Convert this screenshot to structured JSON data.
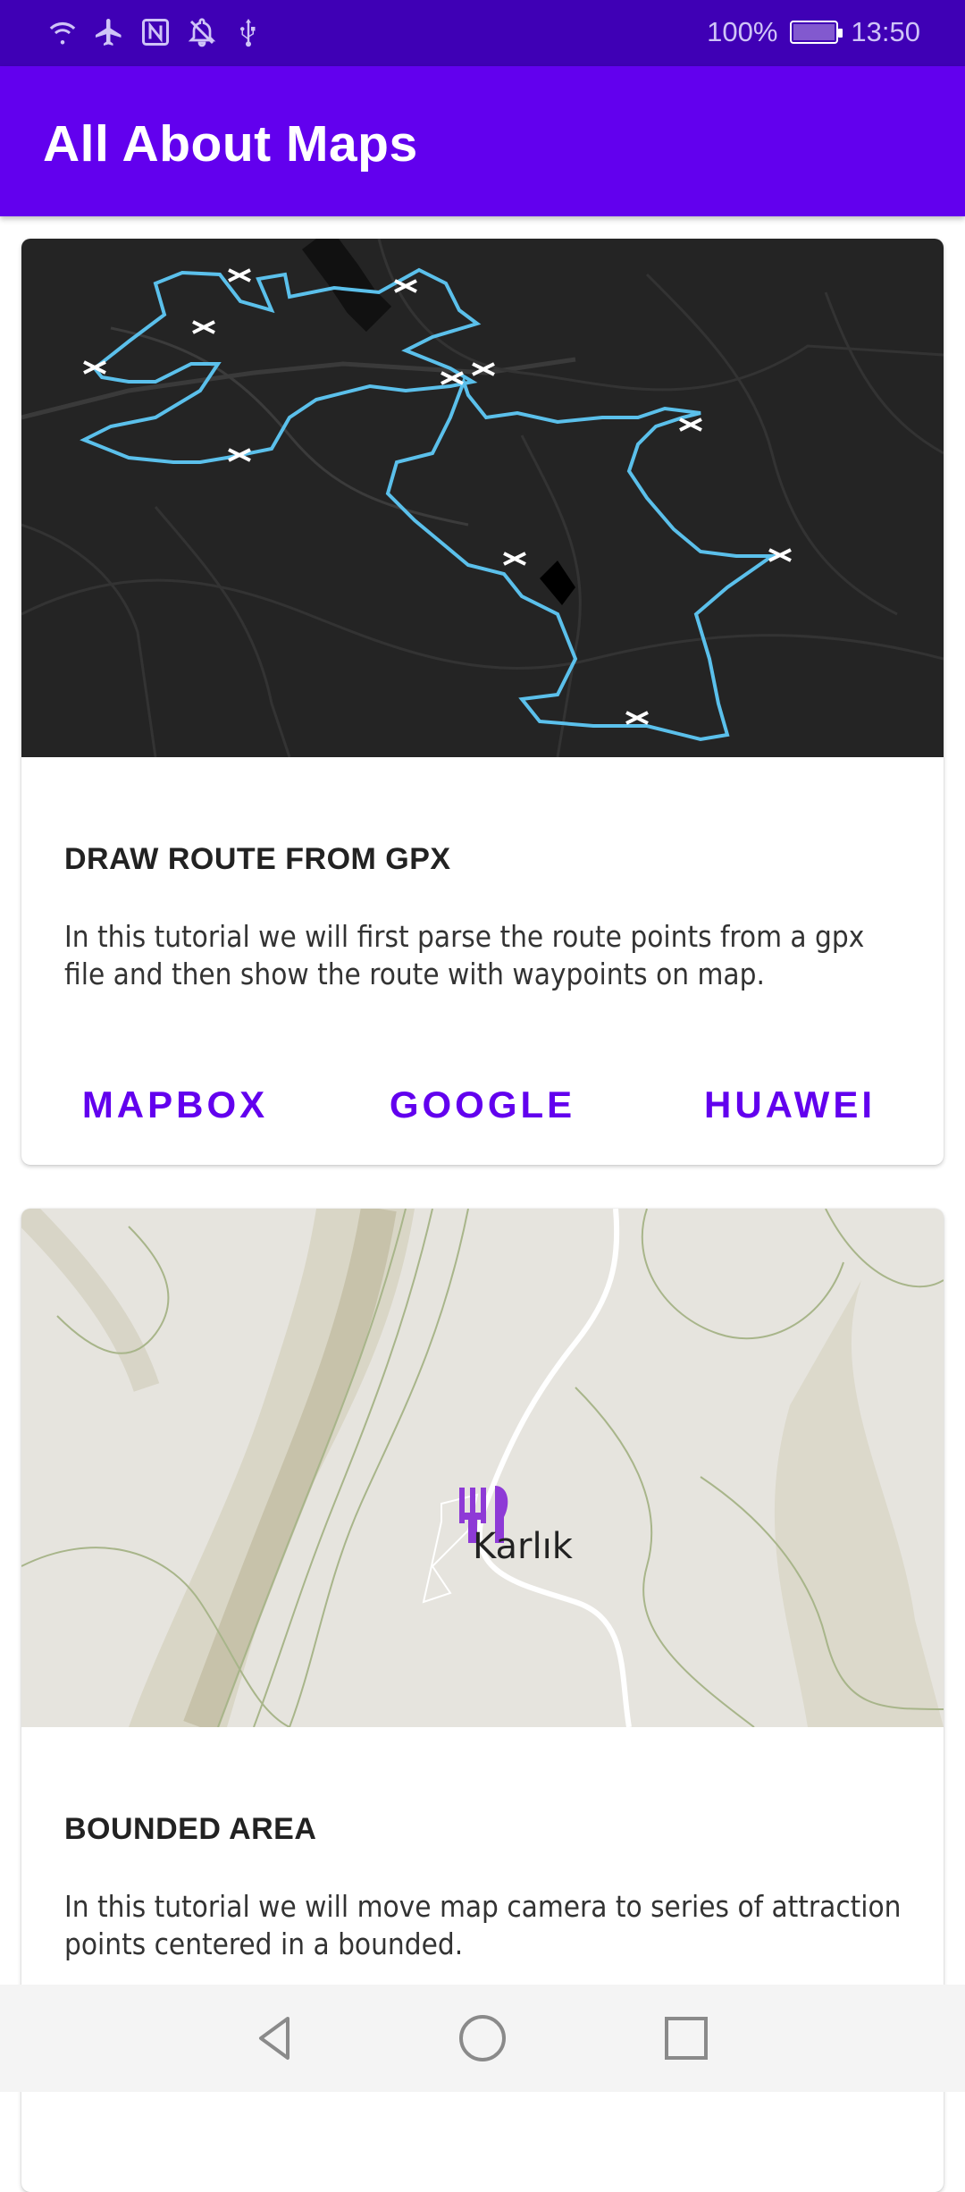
{
  "status_bar": {
    "left_icons": [
      "wifi-icon",
      "airplane-icon",
      "nfc-icon",
      "bell-off-icon",
      "usb-icon"
    ],
    "battery_text": "100%",
    "time": "13:50"
  },
  "app_bar": {
    "title": "All About Maps"
  },
  "cards": [
    {
      "title": "DRAW ROUTE FROM GPX",
      "description": "In this tutorial we will first parse the route points from a gpx file and then show the route with waypoints on map.",
      "actions": [
        "MAPBOX",
        "GOOGLE",
        "HUAWEI"
      ]
    },
    {
      "title": "BOUNDED AREA",
      "description": "In this tutorial we will move map camera to series of attraction points centered in a bounded.",
      "map_label": "Karlık"
    }
  ],
  "nav_bar": {
    "icons": [
      "back-icon",
      "home-icon",
      "recents-icon"
    ]
  },
  "colors": {
    "status_bar": "#3f00b5",
    "app_bar": "#6200ee",
    "accent": "#6200ee",
    "route": "#5bc0eb"
  }
}
